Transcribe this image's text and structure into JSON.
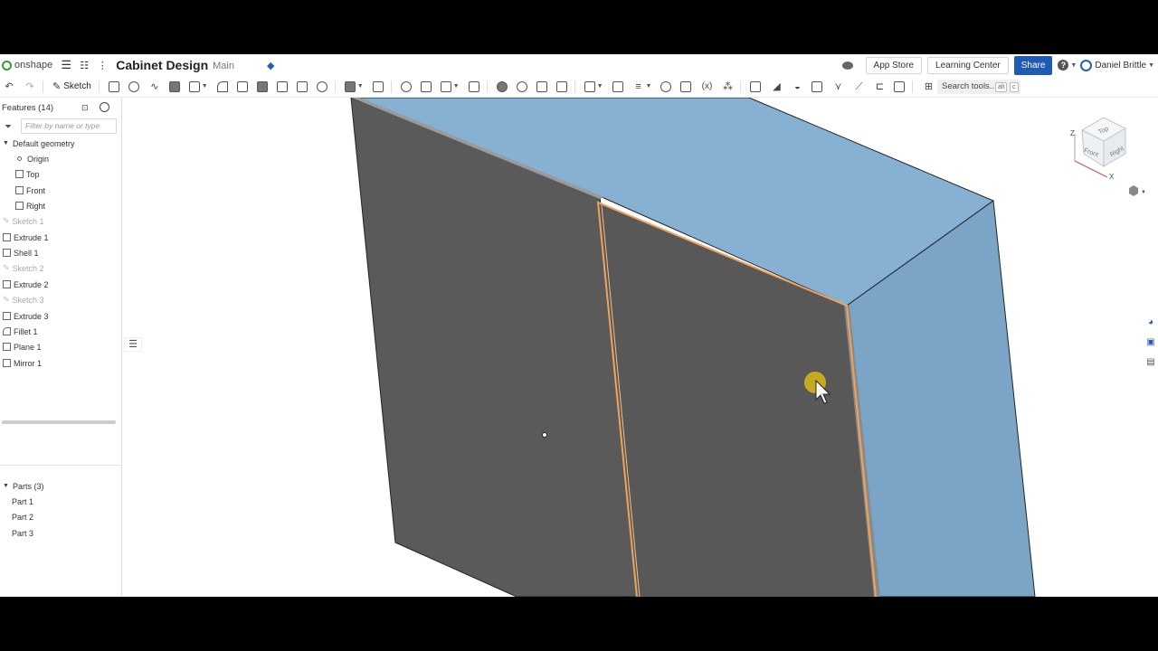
{
  "header": {
    "logo_text": "onshape",
    "document_title": "Cabinet Design",
    "branch": "Main",
    "app_store": "App Store",
    "learning_center": "Learning Center",
    "share": "Share",
    "help_symbol": "?",
    "user_name": "Daniel Brittle"
  },
  "toolbar": {
    "sketch_label": "Sketch",
    "search_placeholder": "Search tools...",
    "search_shortcut_1": "alt",
    "search_shortcut_2": "c",
    "icons": [
      "undo-icon",
      "redo-icon",
      "sketch-icon",
      "extrude-icon",
      "revolve-icon",
      "sweep-icon",
      "loft-icon",
      "thicken-icon",
      "fillet-icon",
      "chamfer-icon",
      "draft-icon",
      "rib-icon",
      "shell-icon",
      "hole-icon",
      "plane-icon",
      "boolean-icon",
      "split-icon",
      "transform-icon",
      "pattern-icon",
      "mirror-icon",
      "variable-icon"
    ]
  },
  "features": {
    "title": "Features (14)",
    "filter_placeholder": "Filter by name or type",
    "default_geometry": "Default geometry",
    "default_items": [
      {
        "label": "Origin",
        "icon": "origin-icon"
      },
      {
        "label": "Top",
        "icon": "plane-icon"
      },
      {
        "label": "Front",
        "icon": "plane-icon"
      },
      {
        "label": "Right",
        "icon": "plane-icon"
      }
    ],
    "items": [
      {
        "label": "Sketch 1",
        "dim": true,
        "icon": "sketch-icon"
      },
      {
        "label": "Extrude 1",
        "dim": false,
        "icon": "extrude-icon"
      },
      {
        "label": "Shell 1",
        "dim": false,
        "icon": "shell-icon"
      },
      {
        "label": "Sketch 2",
        "dim": true,
        "icon": "sketch-icon"
      },
      {
        "label": "Extrude 2",
        "dim": false,
        "icon": "extrude-icon"
      },
      {
        "label": "Sketch 3",
        "dim": true,
        "icon": "sketch-icon"
      },
      {
        "label": "Extrude 3",
        "dim": false,
        "icon": "extrude-icon"
      },
      {
        "label": "Fillet 1",
        "dim": false,
        "icon": "fillet-icon"
      },
      {
        "label": "Plane 1",
        "dim": false,
        "icon": "plane-icon"
      },
      {
        "label": "Mirror 1",
        "dim": false,
        "icon": "mirror-icon"
      }
    ]
  },
  "parts": {
    "title": "Parts (3)",
    "items": [
      "Part 1",
      "Part 2",
      "Part 3"
    ]
  },
  "view_cube": {
    "top": "Top",
    "front": "Front",
    "right": "Right",
    "axis_z": "Z",
    "axis_x": "X"
  },
  "colors": {
    "share_blue": "#1f5bb5",
    "cabinet_top": "#86b1d2",
    "cabinet_side": "#7aa5c7",
    "door_face": "#585858",
    "selection_edge": "#f0a35a",
    "cursor_highlight": "#d4b31c"
  }
}
